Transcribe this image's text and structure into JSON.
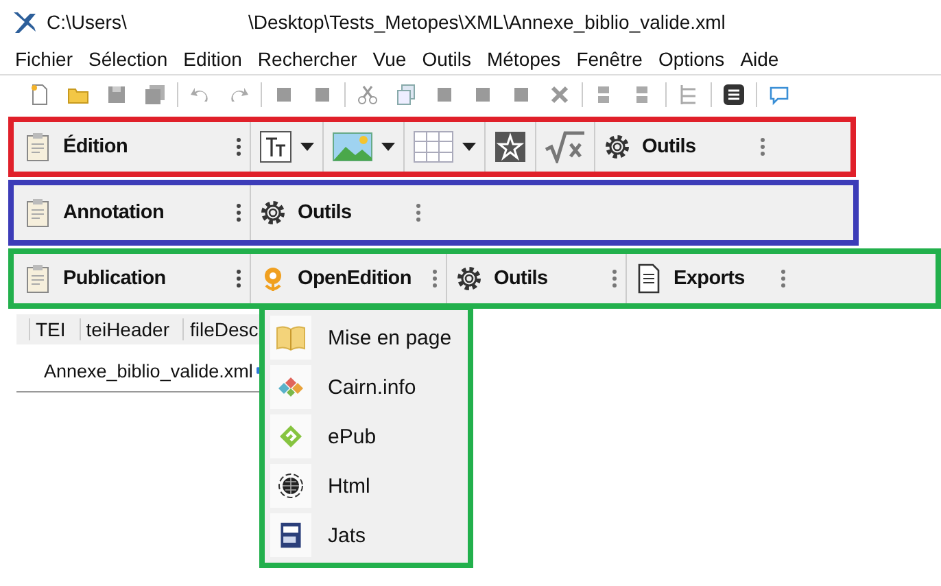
{
  "window": {
    "title_left": "C:\\Users\\",
    "title_right": "\\Desktop\\Tests_Metopes\\XML\\Annexe_biblio_valide.xml"
  },
  "menu_bar": [
    "Fichier",
    "Sélection",
    "Edition",
    "Rechercher",
    "Vue",
    "Outils",
    "Métopes",
    "Fenêtre",
    "Options",
    "Aide"
  ],
  "toolbars": [
    {
      "color": "#e0202a",
      "items": [
        {
          "kind": "title",
          "text": "Édition"
        },
        {
          "kind": "textstyle"
        },
        {
          "kind": "image"
        },
        {
          "kind": "table"
        },
        {
          "kind": "special"
        },
        {
          "kind": "formula"
        },
        {
          "kind": "tool",
          "text": "Outils"
        }
      ]
    },
    {
      "color": "#3c3cb8",
      "items": [
        {
          "kind": "title",
          "text": "Annotation"
        },
        {
          "kind": "tool",
          "text": "Outils"
        }
      ]
    },
    {
      "color": "#22b04c",
      "items": [
        {
          "kind": "title",
          "text": "Publication"
        },
        {
          "kind": "brand",
          "text": "OpenEdition"
        },
        {
          "kind": "tool",
          "text": "Outils"
        },
        {
          "kind": "export",
          "text": "Exports"
        }
      ]
    }
  ],
  "breadcrumb": [
    "TEI",
    "teiHeader",
    "fileDesc"
  ],
  "editor_tab": {
    "label": "Annexe_biblio_valide.xml"
  },
  "dropdown": {
    "color": "#22b04c",
    "items": [
      {
        "kind": "book",
        "label": "Mise en page"
      },
      {
        "kind": "diamonds",
        "label": "Cairn.info"
      },
      {
        "kind": "epub",
        "label": "ePub"
      },
      {
        "kind": "globe",
        "label": "Html"
      },
      {
        "kind": "jats",
        "label": "Jats"
      }
    ]
  }
}
